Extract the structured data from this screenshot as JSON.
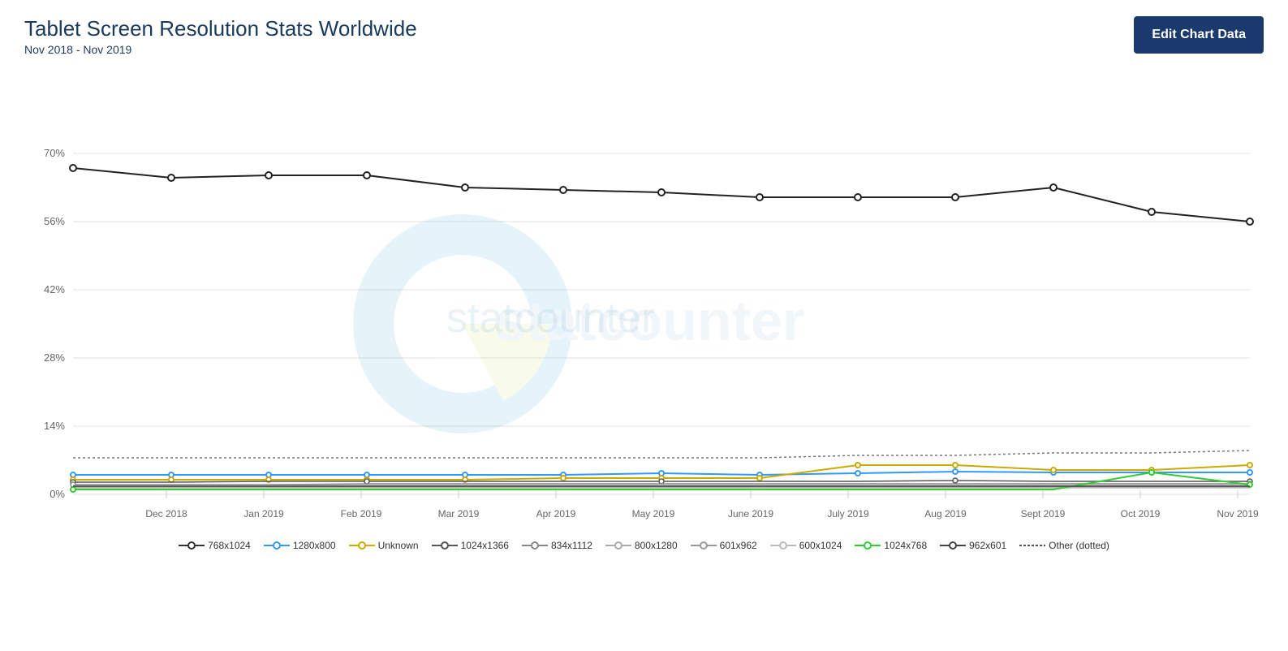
{
  "header": {
    "title": "Tablet Screen Resolution Stats Worldwide",
    "subtitle": "Nov 2018 - Nov 2019",
    "edit_button": "Edit Chart Data"
  },
  "chart": {
    "y_axis_labels": [
      "0%",
      "14%",
      "28%",
      "42%",
      "56%",
      "70%"
    ],
    "x_axis_labels": [
      "Dec 2018",
      "Jan 2019",
      "Feb 2019",
      "Mar 2019",
      "Apr 2019",
      "May 2019",
      "June 2019",
      "July 2019",
      "Aug 2019",
      "Sept 2019",
      "Oct 2019",
      "Nov 2019"
    ],
    "watermark": "statcounter"
  },
  "legend": {
    "items": [
      {
        "label": "768x1024",
        "color": "#333333",
        "style": "solid",
        "dotColor": "#fff"
      },
      {
        "label": "1280x800",
        "color": "#3399ff",
        "style": "solid",
        "dotColor": "#fff"
      },
      {
        "label": "Unknown",
        "color": "#ccaa00",
        "style": "solid",
        "dotColor": "#fff"
      },
      {
        "label": "1024x1366",
        "color": "#555555",
        "style": "solid",
        "dotColor": "#fff"
      },
      {
        "label": "834x1112",
        "color": "#888888",
        "style": "solid",
        "dotColor": "#fff"
      },
      {
        "label": "800x1280",
        "color": "#aaaaaa",
        "style": "solid",
        "dotColor": "#fff"
      },
      {
        "label": "601x962",
        "color": "#999999",
        "style": "solid",
        "dotColor": "#fff"
      },
      {
        "label": "600x1024",
        "color": "#bbbbbb",
        "style": "solid",
        "dotColor": "#fff"
      },
      {
        "label": "1024x768",
        "color": "#33cc33",
        "style": "solid",
        "dotColor": "#fff"
      },
      {
        "label": "962x601",
        "color": "#444444",
        "style": "solid",
        "dotColor": "#fff"
      },
      {
        "label": "Other (dotted)",
        "color": "#555555",
        "style": "dotted",
        "dotColor": "none"
      }
    ]
  }
}
